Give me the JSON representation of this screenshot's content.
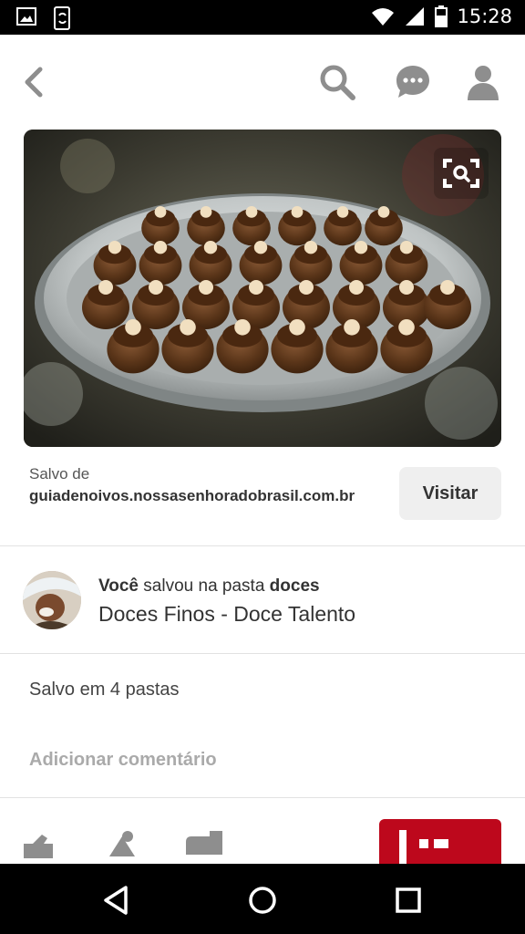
{
  "status_bar": {
    "time": "15:28",
    "icons": [
      "image-icon",
      "phone-sync-icon",
      "wifi-icon",
      "signal-icon",
      "battery-icon"
    ]
  },
  "toolbar": {
    "icons": [
      "back-icon",
      "search-icon",
      "chat-icon",
      "profile-icon"
    ]
  },
  "pin": {
    "image_alt_icon": "zoom-search-icon",
    "saved_from_label": "Salvo de",
    "source_url": "guiadenoivos.nossasenhoradobrasil.com.br",
    "visit_label": "Visitar"
  },
  "activity": {
    "actor": "Você",
    "action": "salvou na pasta",
    "board": "doces",
    "pin_title": "Doces Finos - Doce Talento"
  },
  "saved_in": "Salvo em 4 pastas",
  "comment_placeholder": "Adicionar comentário",
  "colors": {
    "accent": "#bd081c",
    "text": "#333333",
    "muted": "#aaaaaa"
  },
  "navbar": {
    "icons": [
      "back-triangle-icon",
      "home-circle-icon",
      "recents-square-icon"
    ]
  }
}
